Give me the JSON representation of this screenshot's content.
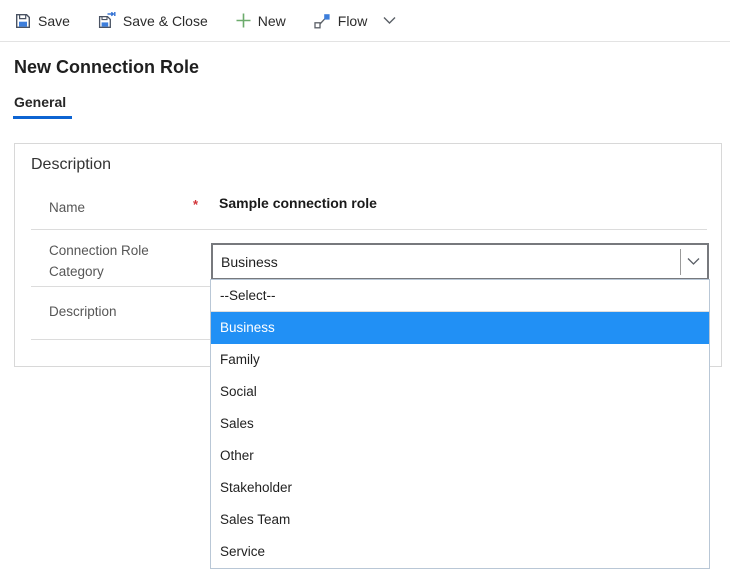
{
  "toolbar": {
    "save": "Save",
    "save_close": "Save & Close",
    "new": "New",
    "flow": "Flow"
  },
  "page": {
    "title": "New Connection Role",
    "tab": "General"
  },
  "form": {
    "section_title": "Description",
    "fields": {
      "name": {
        "label": "Name",
        "required_marker": "*",
        "value": "Sample connection role"
      },
      "category": {
        "label": "Connection Role Category",
        "value": "Business"
      },
      "description": {
        "label": "Description",
        "value": ""
      }
    }
  },
  "dropdown": {
    "options": [
      "--Select--",
      "Business",
      "Family",
      "Social",
      "Sales",
      "Other",
      "Stakeholder",
      "Sales Team",
      "Service"
    ],
    "selected_index": 1
  },
  "colors": {
    "accent_blue": "#0d64d2",
    "highlight_blue": "#2190f5",
    "required_red": "#d13438",
    "new_green": "#6cab6c"
  }
}
